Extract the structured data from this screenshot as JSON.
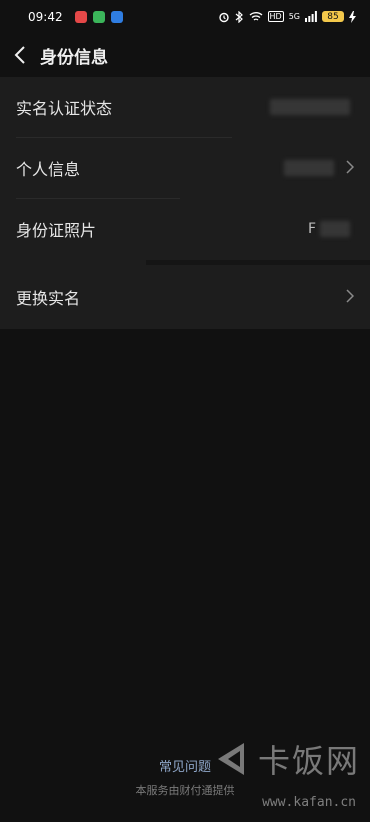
{
  "status": {
    "time": "09:42",
    "battery": "85",
    "network": "5G",
    "hd": "HD"
  },
  "header": {
    "title": "身份信息"
  },
  "rows": [
    {
      "label": "实名认证状态",
      "value": ""
    },
    {
      "label": "个人信息",
      "value": ""
    },
    {
      "label": "身份证照片",
      "value": "F"
    },
    {
      "label": "更换实名",
      "value": ""
    }
  ],
  "footer": {
    "faq": "常见问题",
    "provider": "本服务由财付通提供"
  },
  "watermark": {
    "text": "卡饭网",
    "site": "www.kafan.cn"
  },
  "colors": {
    "background": "#111111",
    "card": "#1d1d1d",
    "link": "#8ea6c8"
  }
}
